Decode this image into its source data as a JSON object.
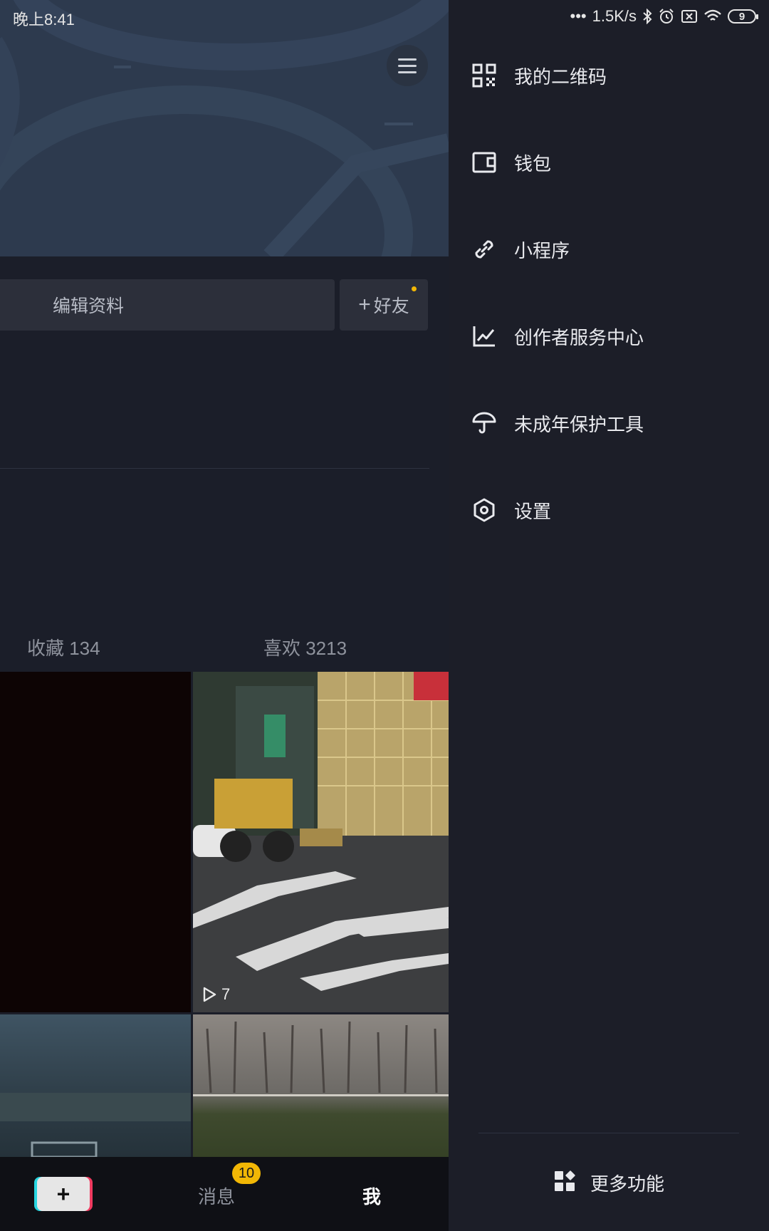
{
  "status": {
    "time": "晚上8:41",
    "net_speed": "1.5K/s",
    "battery": "9"
  },
  "profile": {
    "edit_profile": "编辑资料",
    "add_friend": "好友",
    "tabs": {
      "favorites": "收藏 134",
      "likes": "喜欢 3213"
    },
    "video_play_count": "7"
  },
  "bottom_nav": {
    "messages": "消息",
    "messages_badge": "10",
    "me": "我"
  },
  "drawer": {
    "items": [
      {
        "label": "我的二维码",
        "icon": "qr-code-icon"
      },
      {
        "label": "钱包",
        "icon": "wallet-icon"
      },
      {
        "label": "小程序",
        "icon": "link-icon"
      },
      {
        "label": "创作者服务中心",
        "icon": "chart-icon"
      },
      {
        "label": "未成年保护工具",
        "icon": "umbrella-icon"
      },
      {
        "label": "设置",
        "icon": "settings-hexagon-icon"
      }
    ],
    "more": "更多功能"
  },
  "colors": {
    "drawer_bg": "#1c1e28",
    "badge": "#f2b705",
    "accent_cyan": "#27d6e0",
    "accent_red": "#f03a5f"
  }
}
